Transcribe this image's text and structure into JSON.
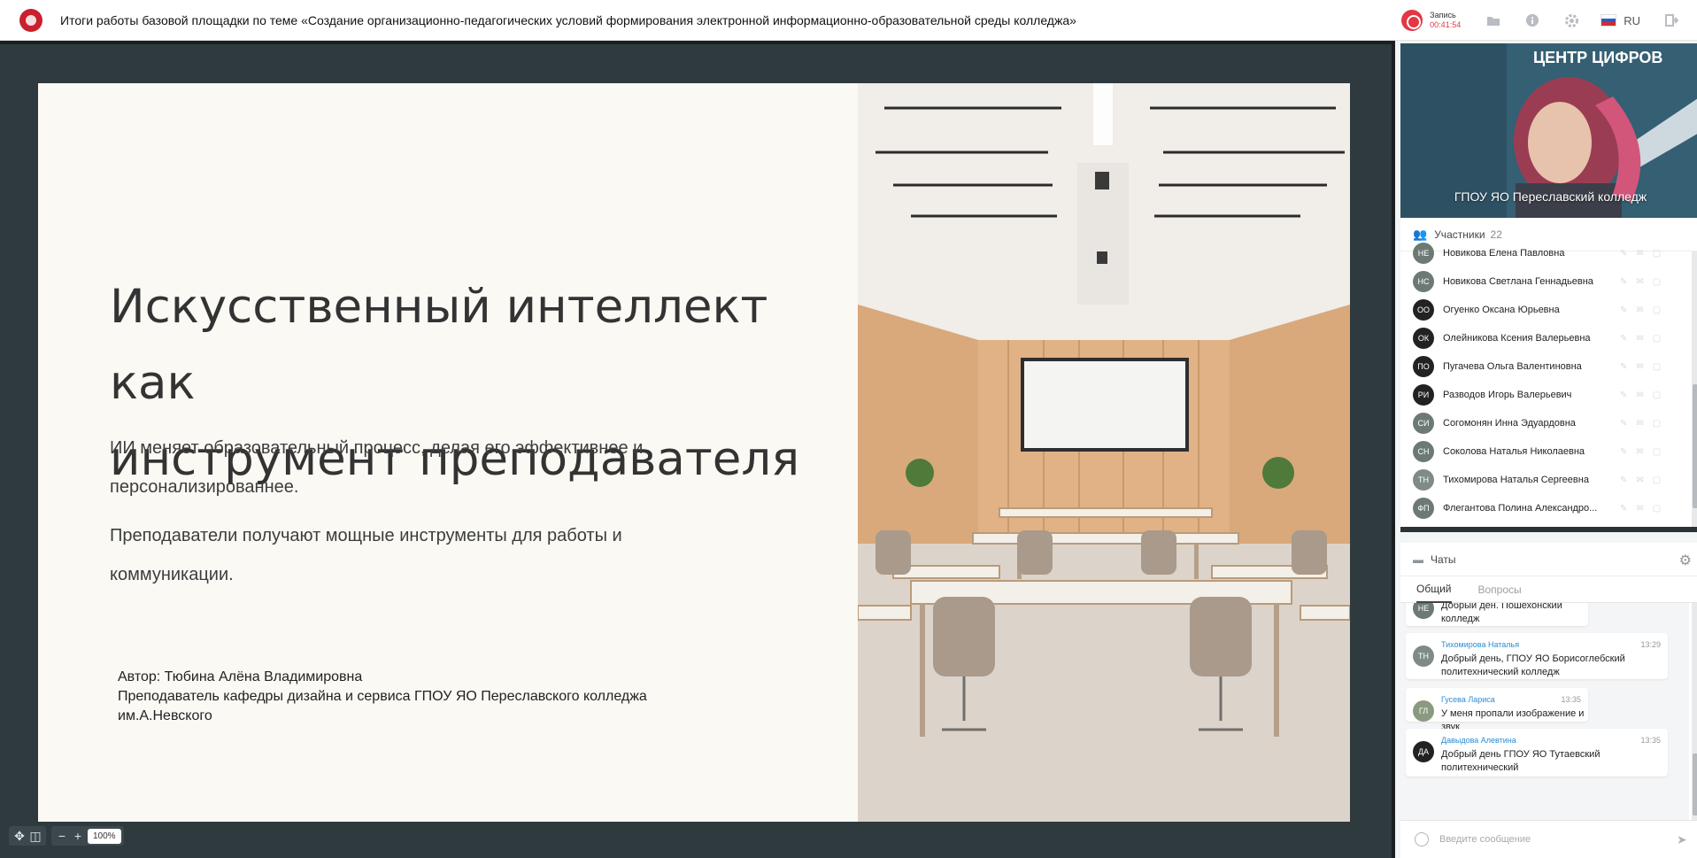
{
  "app": {
    "title": "Итоги работы базовой площадки по теме «Создание организационно-педагогических условий формирования электронной информационно-образовательной среды колледжа»",
    "brand_color": "#c8202e"
  },
  "recording": {
    "label": "Запись",
    "time": "00:41:54",
    "color": "#e23744"
  },
  "toolbar": {
    "icons": [
      "folder-icon",
      "info-icon",
      "settings-icon",
      "flag-ru-icon",
      "exit-icon"
    ],
    "language": "RU"
  },
  "slide": {
    "heading_line1": "Искусственный интеллект как",
    "heading_line2": "инструмент преподавателя",
    "paragraph1_line1": "ИИ меняет образовательный процесс, делая его эффективнее и",
    "paragraph1_line2": "персонализированнее.",
    "paragraph2_line1": "Преподаватели получают мощные инструменты для работы и",
    "paragraph2_line2": "коммуникации.",
    "author_line1": "Автор: Тюбина Алёна Владимировна",
    "author_line2": "Преподаватель кафедры дизайна и сервиса ГПОУ ЯО Переславского колледжа",
    "author_line3": "им.А.Невского"
  },
  "zoom": {
    "value": "100%",
    "minus": "−",
    "plus": "+"
  },
  "video": {
    "name": "ГПОУ ЯО Переславский колледж",
    "background_text": "ЦЕНТР ЦИФРОВ"
  },
  "participants": {
    "title": "Участники",
    "count": "22",
    "list": [
      {
        "initials": "НЕ",
        "name": "Новикова Елена Павловна",
        "color": "#6c7a73"
      },
      {
        "initials": "НС",
        "name": "Новикова Светлана Геннадьевна",
        "color": "#6c7a73"
      },
      {
        "initials": "ОО",
        "name": "Огуенко Оксана Юрьевна",
        "color": "#222222"
      },
      {
        "initials": "ОК",
        "name": "Олейникова Ксения Валерьевна",
        "color": "#222222"
      },
      {
        "initials": "ПО",
        "name": "Пугачева Ольга Валентиновна",
        "color": "#222222"
      },
      {
        "initials": "РИ",
        "name": "Разводов Игорь Валерьевич",
        "color": "#222222"
      },
      {
        "initials": "СИ",
        "name": "Согомонян Инна Эдуардовна",
        "color": "#6c7a73"
      },
      {
        "initials": "СН",
        "name": "Соколова Наталья Николаевна",
        "color": "#6c7a73"
      },
      {
        "initials": "ТН",
        "name": "Тихомирова Наталья Сергеевна",
        "color": "#7f8c85"
      },
      {
        "initials": "ФП",
        "name": "Флегантова Полина Александро...",
        "color": "#6c7a73"
      }
    ]
  },
  "chat": {
    "title": "Чаты",
    "tabs": [
      "Общий",
      "Вопросы"
    ],
    "input_placeholder": "Введите сообщение",
    "messages": [
      {
        "initials": "НЕ",
        "name": "",
        "time": "",
        "text_lines": [
          "Добрый ден. Пошехонский колледж"
        ],
        "color": "#6c7a73"
      },
      {
        "initials": "ТН",
        "name": "Тихомирова Наталья",
        "time": "13:29",
        "text_lines": [
          "Добрый день, ГПОУ ЯО Борисоглебский",
          "политехнический колледж"
        ],
        "color": "#7f8c85"
      },
      {
        "initials": "ГЛ",
        "name": "Гусева Лариса",
        "time": "13:35",
        "text_lines": [
          "У меня пропали изображение и звук"
        ],
        "color": "#8a9a80"
      },
      {
        "initials": "ДА",
        "name": "Давыдова Алевтина",
        "time": "13:35",
        "text_lines": [
          "Добрый день ГПОУ ЯО Тутаевский",
          "политехнический"
        ],
        "color": "#222222"
      }
    ]
  }
}
